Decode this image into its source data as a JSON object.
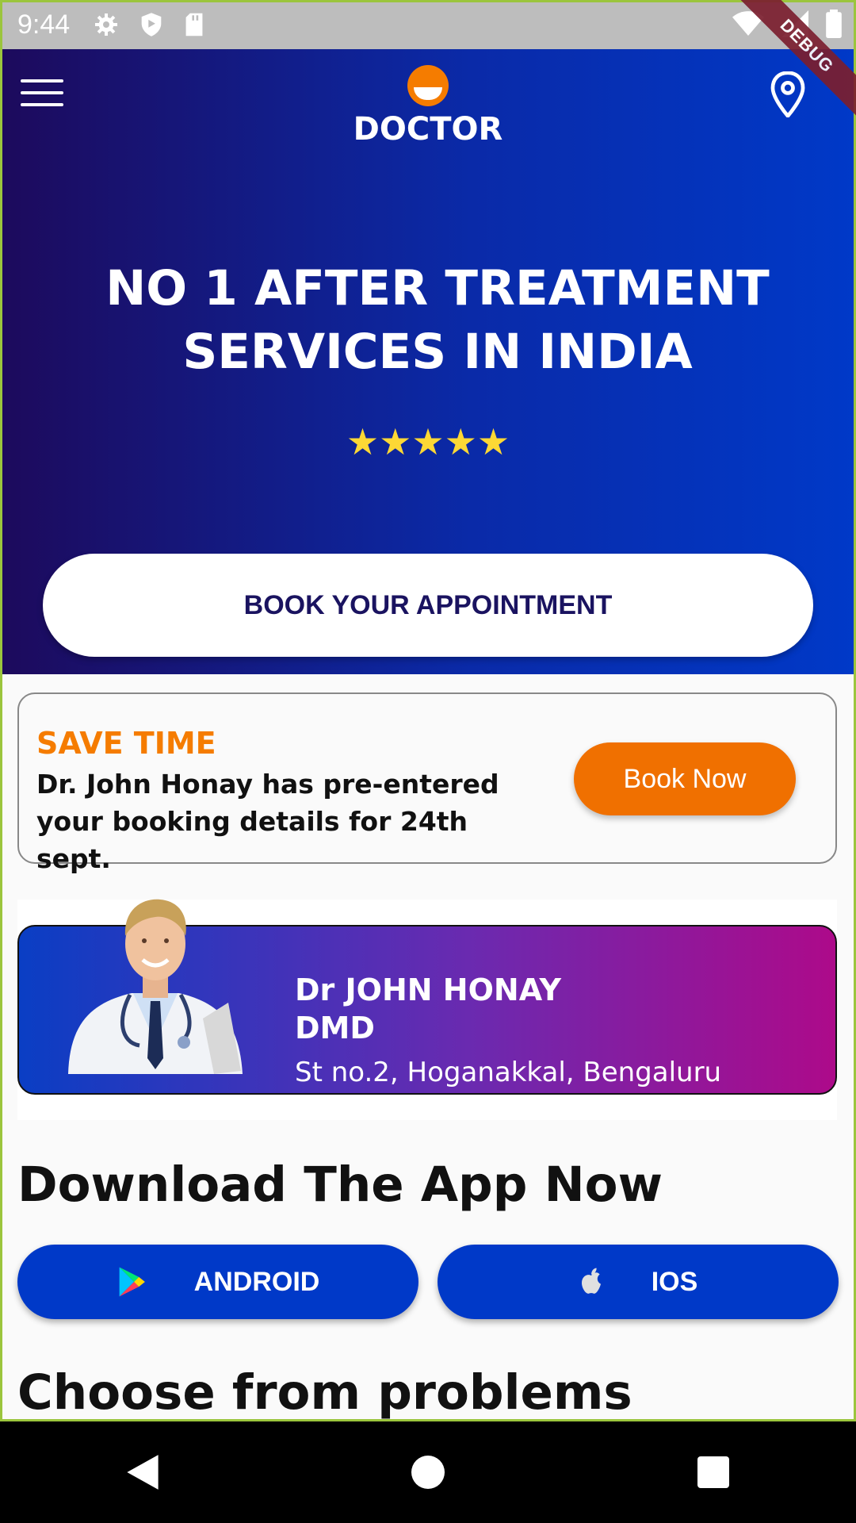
{
  "status_bar": {
    "time": "9:44",
    "debug_banner": "DEBUG",
    "icons": [
      "settings-icon",
      "shield-icon",
      "sd-card-icon",
      "wifi-icon",
      "signal-icon",
      "battery-icon"
    ]
  },
  "header": {
    "logo_text": "DOCTOR",
    "icons": [
      "menu-icon",
      "location-icon"
    ]
  },
  "hero": {
    "headline": "NO 1 AFTER TREATMENT SERVICES IN INDIA",
    "rating": {
      "stars_filled": 5,
      "stars_total": 5
    },
    "book_button": "BOOK YOUR APPOINTMENT"
  },
  "save_time_card": {
    "title": "SAVE TIME",
    "description": "Dr. John Honay has pre-entered your booking details for 24th sept.",
    "button": "Book Now"
  },
  "doctor_card": {
    "name": "Dr JOHN HONAY",
    "degree": "DMD",
    "address": "St no.2, Hoganakkal, Bengaluru"
  },
  "download": {
    "title": "Download The App Now",
    "android_label": "ANDROID",
    "ios_label": "IOS"
  },
  "problems": {
    "title": "Choose from problems"
  },
  "colors": {
    "hero_gradient_start": "#1d0a5c",
    "hero_gradient_end": "#0039c8",
    "accent_orange": "#f57c00",
    "store_button": "#0039c8",
    "doctor_card_gradient_end": "#ad0a8a"
  }
}
